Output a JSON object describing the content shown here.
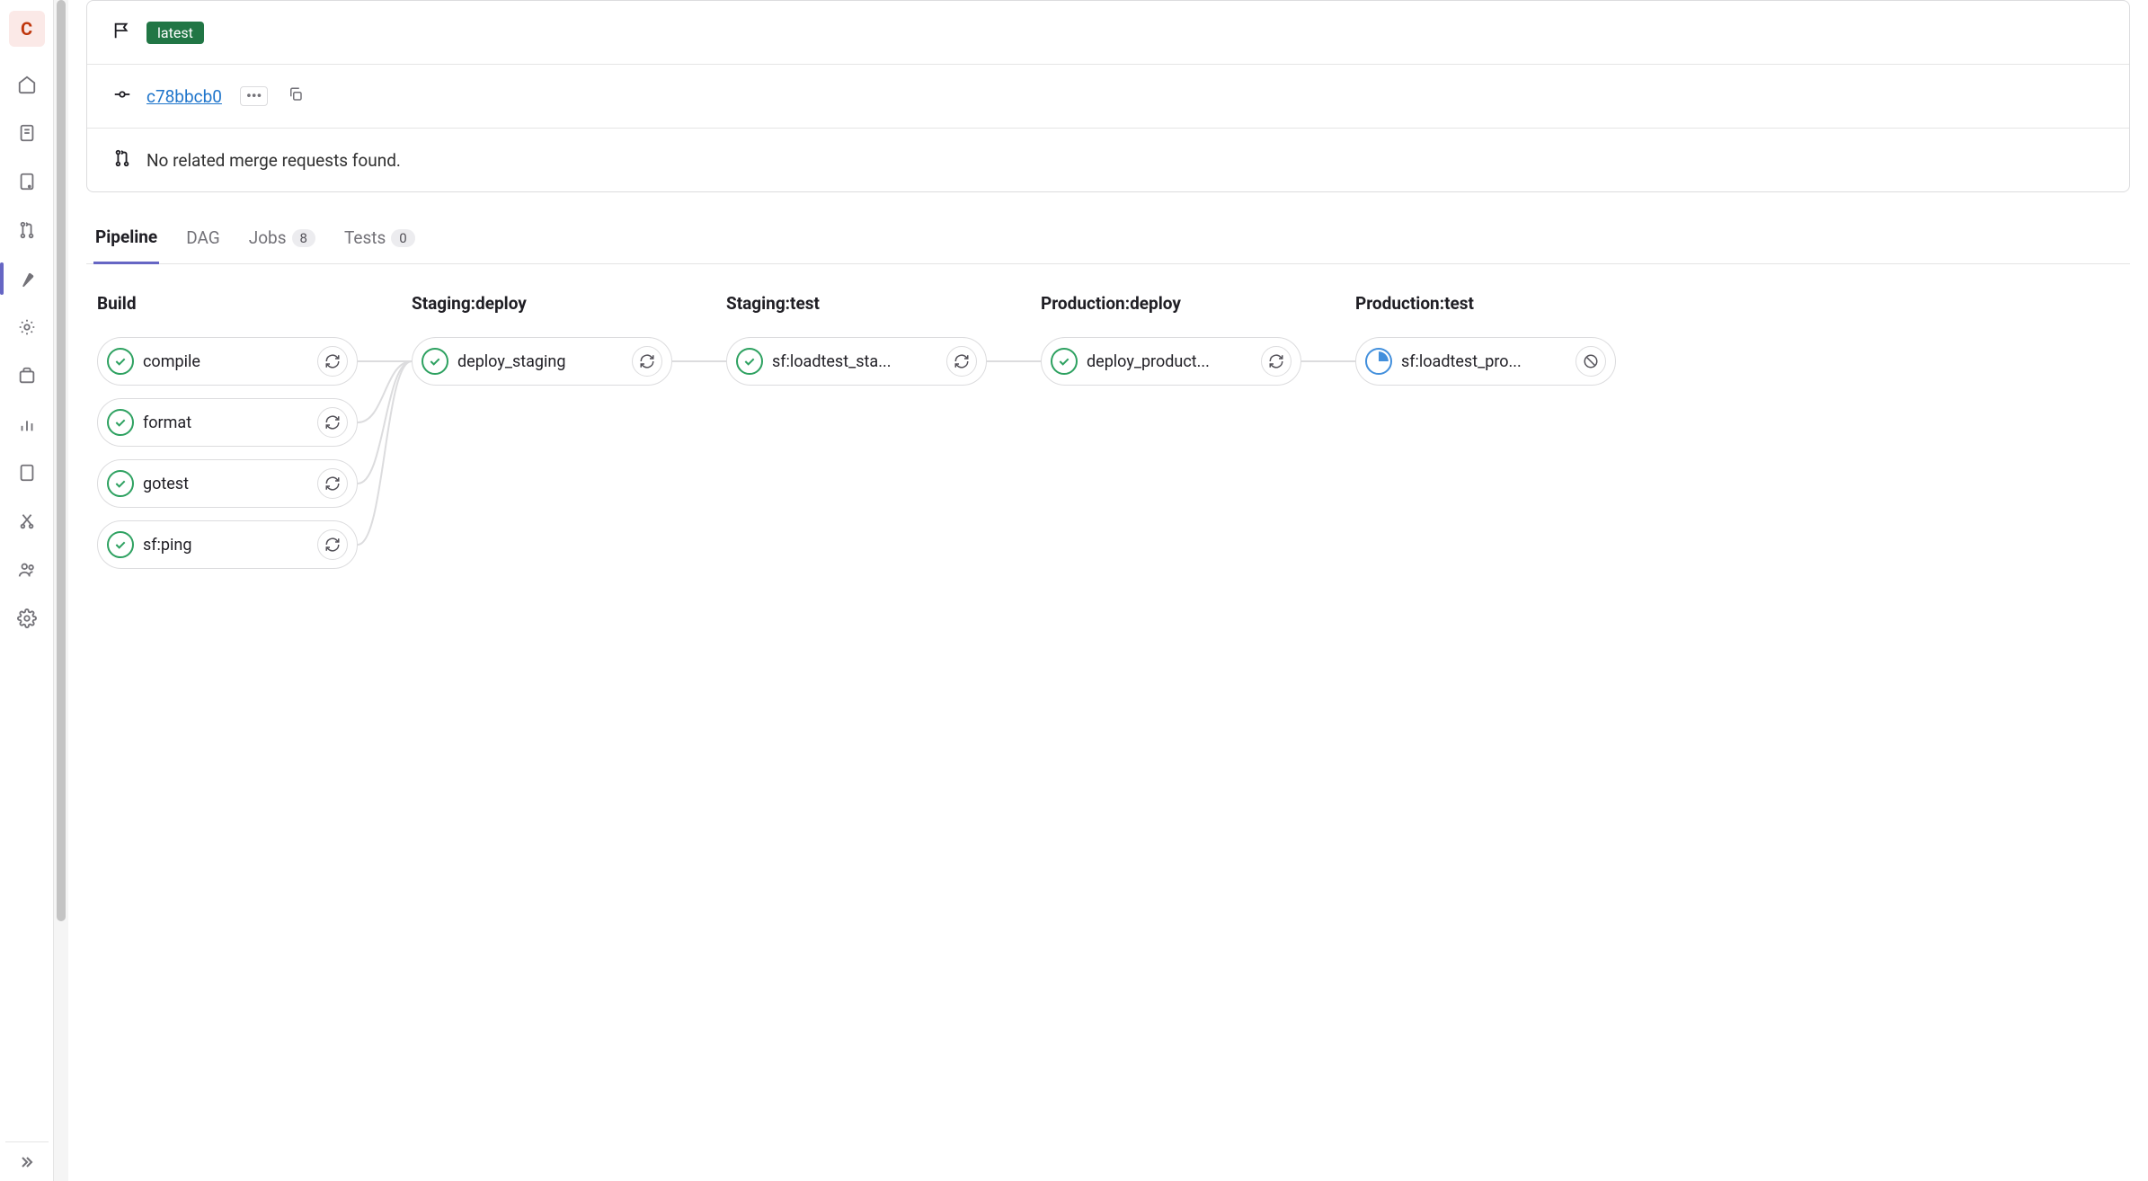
{
  "sidebar": {
    "avatar_letter": "C"
  },
  "header": {
    "badge": "latest",
    "commit_sha": "c78bbcb0",
    "merge_requests_text": "No related merge requests found."
  },
  "tabs": {
    "pipeline": "Pipeline",
    "dag": "DAG",
    "jobs": "Jobs",
    "jobs_count": "8",
    "tests": "Tests",
    "tests_count": "0"
  },
  "stages": [
    {
      "title": "Build",
      "jobs": [
        {
          "name": "compile",
          "status": "success",
          "action": "retry"
        },
        {
          "name": "format",
          "status": "success",
          "action": "retry"
        },
        {
          "name": "gotest",
          "status": "success",
          "action": "retry"
        },
        {
          "name": "sf:ping",
          "status": "success",
          "action": "retry"
        }
      ]
    },
    {
      "title": "Staging:deploy",
      "jobs": [
        {
          "name": "deploy_staging",
          "status": "success",
          "action": "retry"
        }
      ]
    },
    {
      "title": "Staging:test",
      "jobs": [
        {
          "name": "sf:loadtest_sta...",
          "status": "success",
          "action": "retry"
        }
      ]
    },
    {
      "title": "Production:deploy",
      "jobs": [
        {
          "name": "deploy_product...",
          "status": "success",
          "action": "retry"
        }
      ]
    },
    {
      "title": "Production:test",
      "jobs": [
        {
          "name": "sf:loadtest_pro...",
          "status": "running",
          "action": "cancel"
        }
      ]
    }
  ]
}
